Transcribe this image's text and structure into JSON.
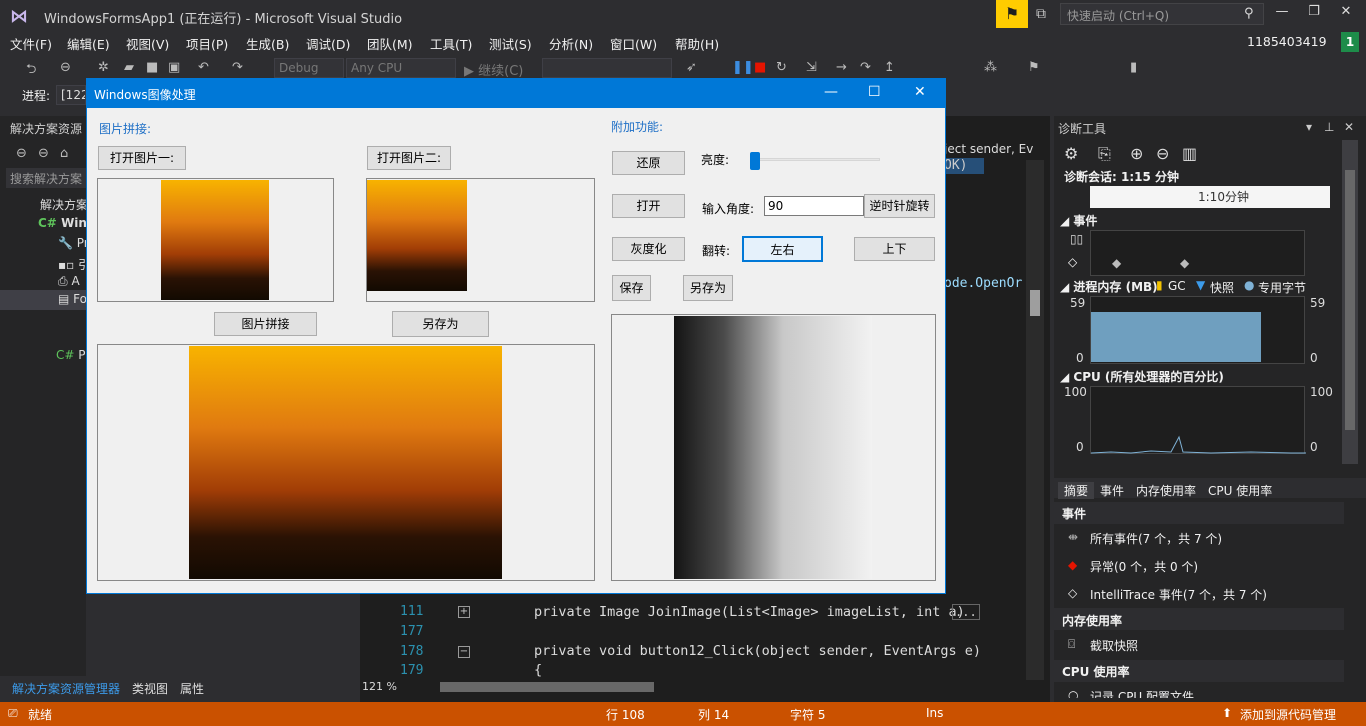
{
  "window": {
    "title": "WindowsFormsApp1 (正在运行) - Microsoft Visual Studio",
    "quick_launch_placeholder": "快速启动 (Ctrl+Q)",
    "user": "1185403419",
    "user_badge": "1",
    "notification_icon": "funnel-flag-icon"
  },
  "menu": [
    "文件(F)",
    "编辑(E)",
    "视图(V)",
    "项目(P)",
    "生成(B)",
    "调试(D)",
    "团队(M)",
    "工具(T)",
    "测试(S)",
    "分析(N)",
    "窗口(W)",
    "帮助(H)"
  ],
  "toolbar": {
    "config": "Debug",
    "platform": "Any CPU",
    "continue_label": "继续(C)",
    "process_label": "进程:",
    "process_value": "[122"
  },
  "solution_explorer": {
    "title": "解决方案资源",
    "search_placeholder": "搜索解决方案",
    "items": [
      "解决方案",
      "Wind",
      "Pr",
      "引",
      "A",
      "Fo",
      "Pr"
    ]
  },
  "bottom_tabs": [
    "解决方案资源管理器",
    "类视图",
    "属性"
  ],
  "editor": {
    "tab_fragment": "ject sender, Ev",
    "ok_fragment": "OK)",
    "mode_fragment": "ode.OpenOr",
    "line_numbers": [
      "111",
      "177",
      "178",
      "179"
    ],
    "line_111": "private Image JoinImage(List<Image> imageList, int a)",
    "line_111_collapsed": "...",
    "line_178": "private void button12_Click(object sender, EventArgs e)",
    "line_179": "{",
    "zoom": "121 %"
  },
  "diagnostics": {
    "title": "诊断工具",
    "session": "诊断会话: 1:15 分钟",
    "timeline_label": "1:10分钟",
    "events_header": "事件",
    "memory_header": "进程内存 (MB)",
    "memory_legend": [
      "GC",
      "快照",
      "专用字节"
    ],
    "memory_max": "59",
    "memory_min": "0",
    "memory_value": 0.78,
    "cpu_header": "CPU (所有处理器的百分比)",
    "cpu_max": "100",
    "cpu_min": "0",
    "tabs": [
      "摘要",
      "事件",
      "内存使用率",
      "CPU 使用率"
    ],
    "events_section": "事件",
    "all_events": "所有事件(7 个，共 7 个)",
    "exceptions": "异常(0 个，共 0 个)",
    "intellitrace": "IntelliTrace 事件(7 个，共 7 个)",
    "memory_section": "内存使用率",
    "snapshot": "截取快照",
    "cpu_section": "CPU 使用率",
    "cpu_profile": "记录 CPU 配置文件"
  },
  "status": {
    "ready": "就绪",
    "row": "行 108",
    "col": "列 14",
    "char": "字符 5",
    "ins": "Ins",
    "source_control": "添加到源代码管理"
  },
  "form": {
    "title": "Windows图像处理",
    "stitch_group": "图片拼接:",
    "open1": "打开图片一:",
    "open2": "打开图片二:",
    "stitch_button": "图片拼接",
    "save_as_left": "另存为",
    "extra_group": "附加功能:",
    "restore": "还原",
    "brightness_label": "亮度:",
    "brightness_value": 0.02,
    "open": "打开",
    "angle_label": "输入角度:",
    "angle_value": "90",
    "rotate_ccw": "逆时针旋转",
    "grayscale": "灰度化",
    "flip_label": "翻转:",
    "flip_lr": "左右",
    "flip_ud": "上下",
    "save": "保存",
    "save_as_right": "另存为"
  }
}
